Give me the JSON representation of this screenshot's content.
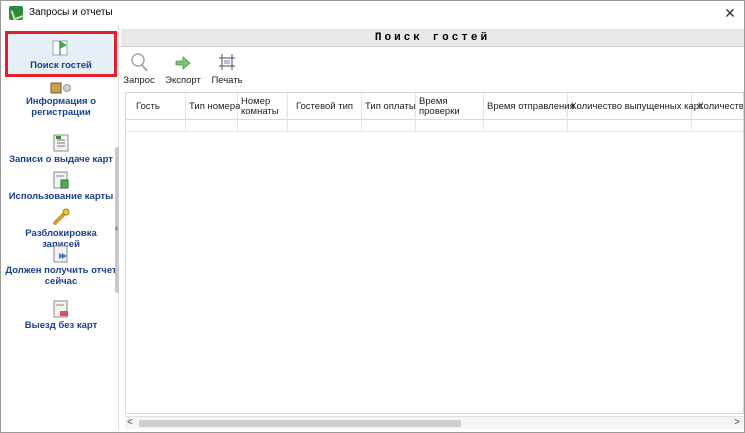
{
  "window": {
    "title": "Запросы и отчеты",
    "close_label": "✕"
  },
  "sidebar": {
    "items": [
      {
        "label": "Поиск гостей",
        "icon": "search-flag-icon",
        "active": true
      },
      {
        "label": "Информация о регистрации",
        "icon": "registration-info-icon"
      },
      {
        "label": "Записи о выдаче карт",
        "icon": "card-issue-records-icon"
      },
      {
        "label": "Использование карты",
        "icon": "card-usage-icon"
      },
      {
        "label": "Разблокировка записей",
        "icon": "unlock-records-icon"
      },
      {
        "label": "Должен получить отчет сейчас",
        "icon": "report-now-icon"
      },
      {
        "label": "Выезд без карт",
        "icon": "checkout-no-card-icon"
      }
    ],
    "collapse_arrow": "‹"
  },
  "main": {
    "title": "Поиск гостей",
    "toolbar": {
      "query_label": "Запрос",
      "export_label": "Экспорт",
      "print_label": "Печать"
    },
    "table": {
      "columns": [
        "Гость",
        "Тип номера",
        "Номер комнаты",
        "Гостевой тип",
        "Тип оплаты",
        "Время проверки",
        "Время отправления",
        "Количество выпущенных карт",
        "Количество"
      ],
      "rows": []
    },
    "hscroll": {
      "left_arrow": "<",
      "right_arrow": ">"
    }
  },
  "colors": {
    "active_border": "#e0202a",
    "sidebar_text": "#1a3f8f",
    "title_bar": "#e8e8e8"
  }
}
